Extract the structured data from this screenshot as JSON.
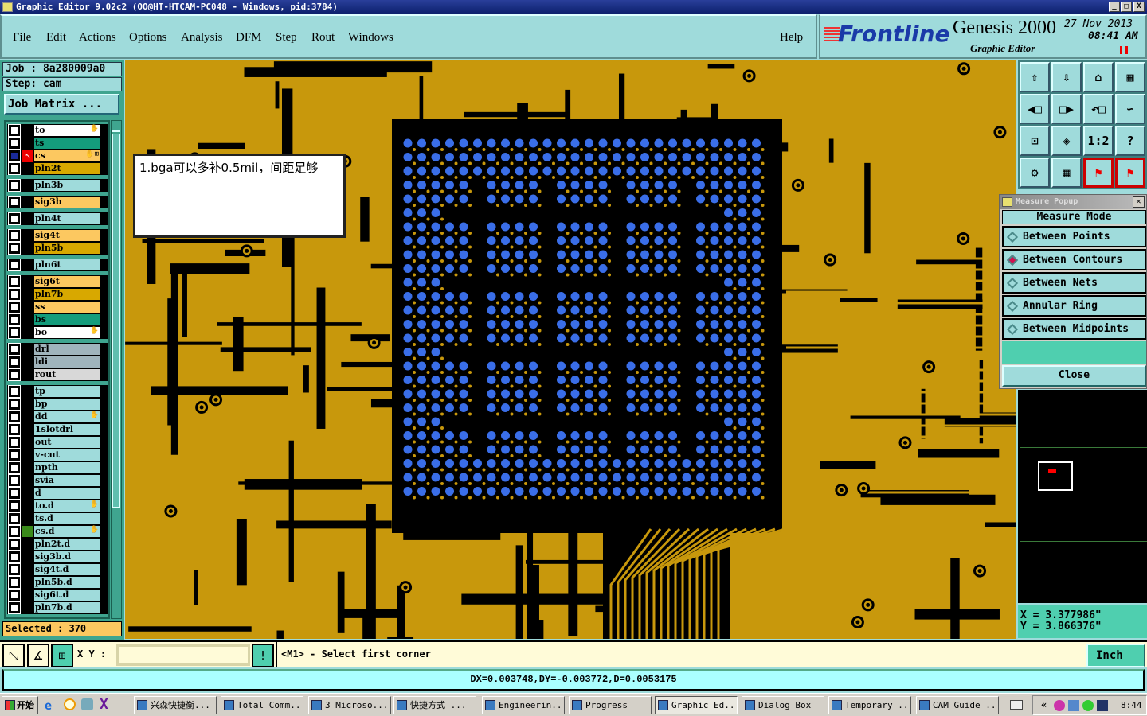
{
  "window": {
    "title": "Graphic Editor 9.02c2 (OO@HT-HTCAM-PC048 - Windows, pid:3784)",
    "min": "_",
    "max": "□",
    "close": "X"
  },
  "menu": [
    "File",
    "Edit",
    "Actions",
    "Options",
    "Analysis",
    "DFM",
    "Step",
    "Rout",
    "Windows",
    "Help"
  ],
  "logo": {
    "brand": "Frontline",
    "product": "Genesis 2000",
    "sub": "Graphic Editor",
    "date": "27 Nov 2013",
    "time": "08:41 AM"
  },
  "job": "Job : 8a280009a0",
  "step": "Step: cam",
  "job_matrix": "Job Matrix ...",
  "layers": [
    {
      "name": "to",
      "color": "#ffffff",
      "mark": "✋"
    },
    {
      "name": "ts",
      "color": "#149c7c"
    },
    {
      "name": "cs",
      "color": "#fcc860",
      "mark": "✋⊞",
      "active": true
    },
    {
      "name": "pln2t",
      "color": "#d8a800"
    },
    {
      "name": "pln3b",
      "color": "#9fdbdb"
    },
    {
      "name": "sig3b",
      "color": "#fcc860"
    },
    {
      "name": "pln4t",
      "color": "#9fdbdb"
    },
    {
      "name": "sig4t",
      "color": "#fcc860"
    },
    {
      "name": "pln5b",
      "color": "#d8a800"
    },
    {
      "name": "pln6t",
      "color": "#9fdbdb"
    },
    {
      "name": "sig6t",
      "color": "#fcc860"
    },
    {
      "name": "pln7b",
      "color": "#d8a800"
    },
    {
      "name": "ss",
      "color": "#fcc860"
    },
    {
      "name": "bs",
      "color": "#149c7c"
    },
    {
      "name": "bo",
      "color": "#ffffff",
      "mark": "✋"
    },
    {
      "name": "drl",
      "color": "#a0b4bc"
    },
    {
      "name": "ldi",
      "color": "#a0b4bc"
    },
    {
      "name": "rout",
      "color": "#d8d8d8"
    },
    {
      "name": "tp",
      "color": "#9fdbdb"
    },
    {
      "name": "bp",
      "color": "#9fdbdb"
    },
    {
      "name": "dd",
      "color": "#9fdbdb",
      "mark": "✋"
    },
    {
      "name": "1slotdrl",
      "color": "#9fdbdb"
    },
    {
      "name": "out",
      "color": "#9fdbdb"
    },
    {
      "name": "v-cut",
      "color": "#9fdbdb"
    },
    {
      "name": "npth",
      "color": "#9fdbdb"
    },
    {
      "name": "svia",
      "color": "#9fdbdb"
    },
    {
      "name": "d",
      "color": "#9fdbdb"
    },
    {
      "name": "to.d",
      "color": "#9fdbdb",
      "mark": "✋"
    },
    {
      "name": "ts.d",
      "color": "#9fdbdb"
    },
    {
      "name": "cs.d",
      "color": "#9fdbdb",
      "mark": "✋",
      "board": true
    },
    {
      "name": "pln2t.d",
      "color": "#9fdbdb"
    },
    {
      "name": "sig3b.d",
      "color": "#9fdbdb"
    },
    {
      "name": "sig4t.d",
      "color": "#9fdbdb"
    },
    {
      "name": "pln5b.d",
      "color": "#9fdbdb"
    },
    {
      "name": "sig6t.d",
      "color": "#9fdbdb"
    },
    {
      "name": "pln7b.d",
      "color": "#9fdbdb"
    }
  ],
  "selected": "Selected : 370",
  "note": "1.bga可以多补0.5mil，间距足够",
  "toolbar_icons": [
    "zoom-home-up-icon",
    "zoom-down-icon",
    "home-icon",
    "layout-xy-icon",
    "pan-left-icon",
    "pan-right-icon",
    "undo-view-icon",
    "snake-icon",
    "zoom-in-icon",
    "zoom-out-icon",
    "scale-1-2-icon",
    "help-icon",
    "settings-palette-icon",
    "grid-icon",
    "net-highlight-icon",
    "net-drc-icon"
  ],
  "toolbar_labels": {
    "scale": "1:2",
    "help": "?"
  },
  "measure": {
    "title": "Measure Popup",
    "header": "Measure Mode",
    "modes": [
      "Between Points",
      "Between Contours",
      "Between Nets",
      "Annular Ring",
      "Between Midpoints"
    ],
    "selected": "Between Contours",
    "close": "Close"
  },
  "coords": {
    "x": "X = 3.377986\"",
    "y": "Y = 3.866376\""
  },
  "cmd": {
    "xy_label": "X Y :",
    "xy_value": "",
    "prompt": "<M1> - Select first corner",
    "unit": "Inch"
  },
  "status": "DX=0.003748,DY=-0.003772,D=0.0053175",
  "taskbar": {
    "start": "开始",
    "tasks": [
      "兴森快捷衡...",
      "Total Comm...",
      "3 Microso...",
      "快捷方式 ...",
      "Engineerin...",
      "Progress",
      "Graphic Ed...",
      "Dialog Box",
      "Temporary ...",
      "CAM_Guide ..."
    ],
    "active": "Graphic Ed...",
    "clock": "8:44"
  },
  "colors": {
    "copper": "#c8980c",
    "pad": "#3a6ee8",
    "panel": "#9fdbdb"
  }
}
